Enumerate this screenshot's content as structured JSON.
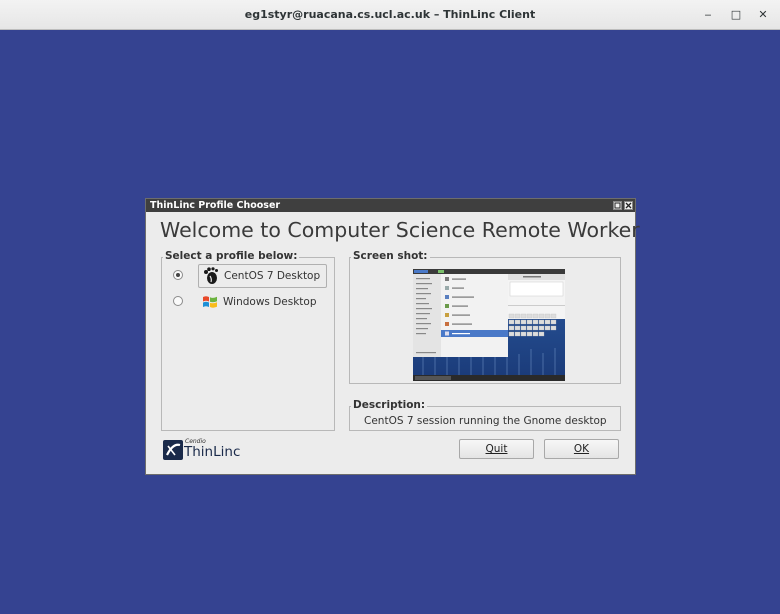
{
  "window": {
    "title": "eg1styr@ruacana.cs.ucl.ac.uk – ThinLinc Client",
    "minimize_label": "‒",
    "maximize_label": "□",
    "close_label": "✕"
  },
  "dialog": {
    "title": "ThinLinc Profile Chooser",
    "welcome": "Welcome to Computer Science Remote Worker",
    "select_label": "Select a profile below:",
    "profiles": [
      {
        "label": "CentOS 7 Desktop",
        "selected": true,
        "icon": "gnome-foot-icon"
      },
      {
        "label": "Windows Desktop",
        "selected": false,
        "icon": "windows-logo-icon"
      }
    ],
    "screenshot_label": "Screen shot:",
    "description_label": "Description:",
    "description": "CentOS 7 session running the Gnome desktop",
    "logo_small": "Cendio",
    "logo_text": "ThinLinc",
    "quit_label": "Quit",
    "ok_label": "OK"
  },
  "colors": {
    "desktop_bg": "#354391",
    "dialog_title_bg": "#3f3f3f",
    "dialog_bg": "#ececec"
  }
}
